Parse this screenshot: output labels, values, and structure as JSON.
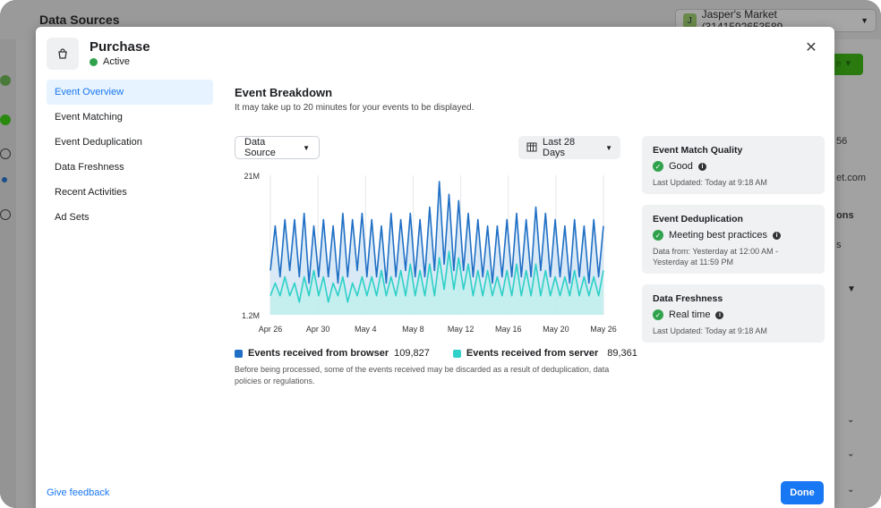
{
  "background": {
    "title": "Data Sources",
    "account": "Jasper's Market (3141592653589...",
    "account_initial": "J",
    "right_texts": [
      "56",
      "et.com",
      "ons",
      "s"
    ]
  },
  "modal": {
    "title": "Purchase",
    "status": "Active",
    "nav": [
      {
        "label": "Event Overview",
        "active": true
      },
      {
        "label": "Event Matching"
      },
      {
        "label": "Event Deduplication"
      },
      {
        "label": "Data Freshness"
      },
      {
        "label": "Recent Activities"
      },
      {
        "label": "Ad Sets"
      }
    ],
    "breakdown": {
      "title": "Event Breakdown",
      "subtitle": "It may take up to 20 minutes for your events to be displayed.",
      "source_dropdown": "Data Source",
      "date_dropdown": "Last 28 Days"
    },
    "legend": {
      "browser_label": "Events received from browser",
      "browser_value": "109,827",
      "server_label": "Events received from server",
      "server_value": "89,361"
    },
    "note": "Before being processed, some of the events received may be discarded as a result of deduplication, data policies or regulations.",
    "cards": [
      {
        "title": "Event Match Quality",
        "status": "Good",
        "meta": "Last Updated: Today at 9:18 AM"
      },
      {
        "title": "Event Deduplication",
        "status": "Meeting best practices",
        "meta": "Data from: Yesterday at 12:00 AM - Yesterday at 11:59 PM"
      },
      {
        "title": "Data Freshness",
        "status": "Real time",
        "meta": "Last Updated: Today at 9:18 AM"
      }
    ],
    "feedback": "Give feedback",
    "done": "Done"
  },
  "colors": {
    "browser": "#1f6fc5",
    "server": "#2ed0c8",
    "accent": "#1877f2"
  },
  "chart_data": {
    "type": "area",
    "ylim_labels": [
      "21M",
      "1.2M"
    ],
    "x_tick_labels": [
      "Apr 26",
      "Apr 30",
      "May 4",
      "May 8",
      "May 12",
      "May 16",
      "May 20",
      "May 26"
    ],
    "series": [
      {
        "name": "Events received from browser",
        "values": [
          7,
          14,
          6,
          15,
          7,
          15,
          6,
          16,
          5,
          14,
          6,
          15,
          6,
          14,
          5,
          16,
          6,
          15,
          7,
          16,
          6,
          15,
          6,
          14,
          5,
          16,
          6,
          15,
          7,
          16,
          6,
          15,
          6,
          17,
          7,
          21,
          8,
          19,
          7,
          18,
          7,
          16,
          6,
          15,
          6,
          14,
          5,
          14,
          6,
          15,
          6,
          16,
          6,
          15,
          6,
          17,
          7,
          16,
          6,
          15,
          6,
          14,
          5,
          15,
          6,
          14,
          5,
          15,
          6,
          14
        ]
      },
      {
        "name": "Events received from server",
        "values": [
          3,
          5,
          3,
          6,
          3,
          5,
          2,
          6,
          3,
          7,
          3,
          6,
          2,
          5,
          3,
          6,
          2,
          5,
          3,
          6,
          3,
          6,
          3,
          7,
          3,
          6,
          3,
          7,
          3,
          8,
          3,
          7,
          3,
          8,
          3,
          9,
          4,
          10,
          4,
          9,
          4,
          8,
          3,
          7,
          3,
          7,
          3,
          6,
          3,
          7,
          3,
          8,
          3,
          7,
          3,
          8,
          3,
          7,
          3,
          6,
          3,
          6,
          3,
          7,
          3,
          6,
          3,
          6,
          3,
          7
        ]
      }
    ]
  }
}
